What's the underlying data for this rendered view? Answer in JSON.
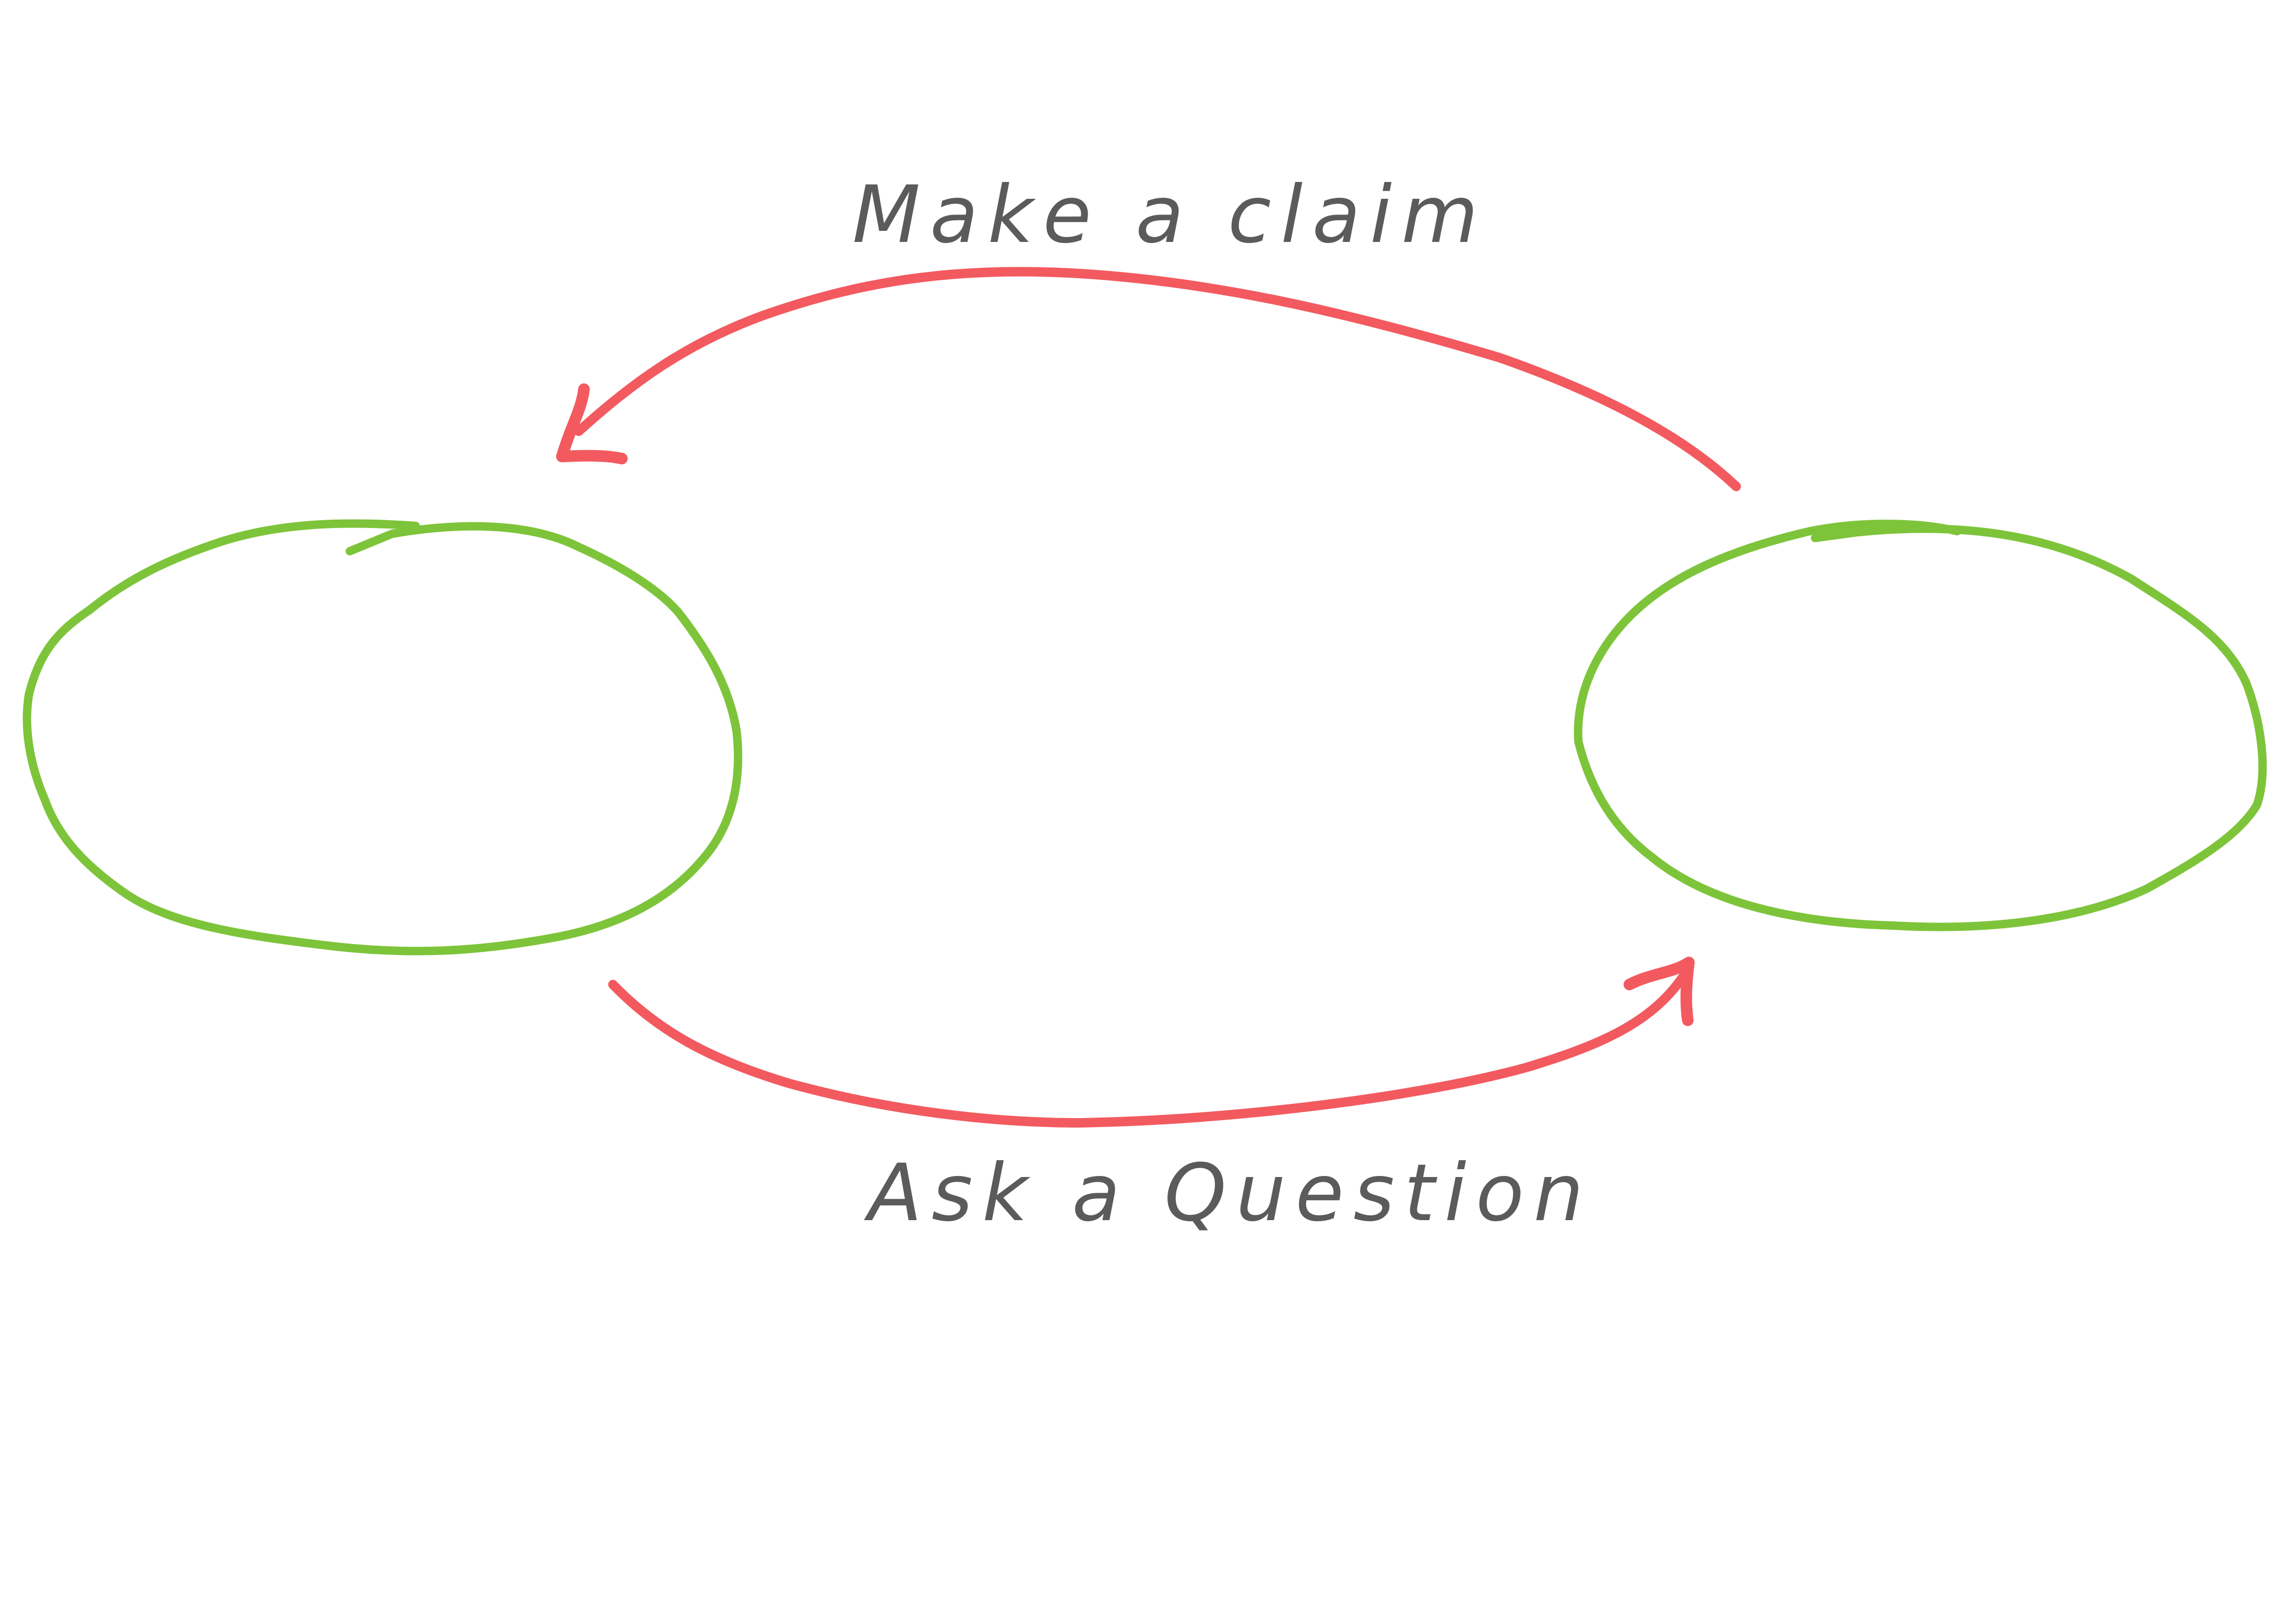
{
  "diagram": {
    "nodes": [
      {
        "id": "left",
        "label": ""
      },
      {
        "id": "right",
        "label": ""
      }
    ],
    "edges": [
      {
        "id": "top",
        "from": "right",
        "to": "left",
        "label": "Make a claim"
      },
      {
        "id": "bottom",
        "from": "left",
        "to": "right",
        "label": "Ask a Question"
      }
    ],
    "colors": {
      "node_stroke": "#7dc43a",
      "edge_stroke": "#f25a5f",
      "label_text": "#5b5b5b",
      "background": "#ffffff"
    }
  }
}
